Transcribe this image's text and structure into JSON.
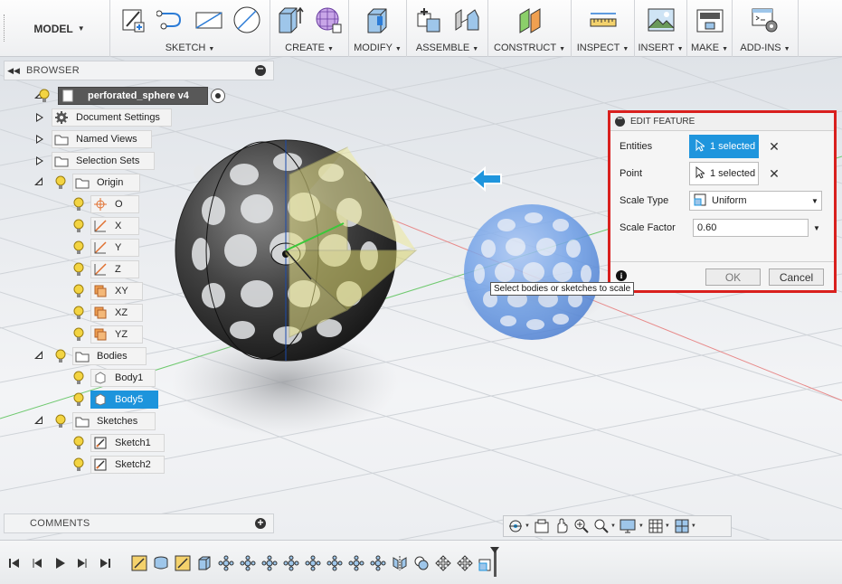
{
  "toolbar": {
    "workspace": "MODEL",
    "groups": [
      {
        "label": "SKETCH",
        "icons": [
          "create-sketch-icon",
          "spline-icon",
          "rectangle-icon",
          "circle-icon"
        ]
      },
      {
        "label": "CREATE",
        "icons": [
          "extrude-icon",
          "box-form-icon"
        ]
      },
      {
        "label": "MODIFY",
        "icons": [
          "press-pull-icon"
        ]
      },
      {
        "label": "ASSEMBLE",
        "icons": [
          "new-component-icon",
          "joint-icon"
        ]
      },
      {
        "label": "CONSTRUCT",
        "icons": [
          "offset-plane-icon"
        ]
      },
      {
        "label": "INSPECT",
        "icons": [
          "measure-icon"
        ]
      },
      {
        "label": "INSERT",
        "icons": [
          "insert-image-icon"
        ]
      },
      {
        "label": "MAKE",
        "icons": [
          "3d-print-icon"
        ]
      },
      {
        "label": "ADD-INS",
        "icons": [
          "scripts-addins-icon"
        ]
      }
    ]
  },
  "browser": {
    "title": "BROWSER",
    "root": "perforated_sphere v4",
    "items": [
      {
        "label": "Document Settings",
        "icon": "gear-icon"
      },
      {
        "label": "Named Views",
        "icon": "folder-icon"
      },
      {
        "label": "Selection Sets",
        "icon": "folder-icon"
      },
      {
        "label": "Origin",
        "icon": "folder-icon"
      },
      {
        "label": "O",
        "icon": "origin-point-icon"
      },
      {
        "label": "X",
        "icon": "axis-icon"
      },
      {
        "label": "Y",
        "icon": "axis-icon"
      },
      {
        "label": "Z",
        "icon": "axis-icon"
      },
      {
        "label": "XY",
        "icon": "plane-icon"
      },
      {
        "label": "XZ",
        "icon": "plane-icon"
      },
      {
        "label": "YZ",
        "icon": "plane-icon"
      },
      {
        "label": "Bodies",
        "icon": "folder-icon"
      },
      {
        "label": "Body1",
        "icon": "body-icon"
      },
      {
        "label": "Body5",
        "icon": "body-icon",
        "selected": true
      },
      {
        "label": "Sketches",
        "icon": "folder-icon"
      },
      {
        "label": "Sketch1",
        "icon": "sketch-icon"
      },
      {
        "label": "Sketch2",
        "icon": "sketch-icon"
      }
    ]
  },
  "comments": {
    "title": "COMMENTS"
  },
  "dialog": {
    "title": "EDIT FEATURE",
    "entities_label": "Entities",
    "entities_value": "1 selected",
    "point_label": "Point",
    "point_value": "1 selected",
    "scale_type_label": "Scale Type",
    "scale_type_value": "Uniform",
    "scale_factor_label": "Scale Factor",
    "scale_factor_value": "0.60",
    "ok": "OK",
    "cancel": "Cancel"
  },
  "tooltip": "Select bodies or sketches to scale",
  "colors": {
    "accent": "#1d94dc",
    "highlight_border": "#d9201e",
    "ghost_body": "#6d9ee6",
    "dark_body": "#3a3a3a"
  },
  "navbar": {
    "icons": [
      "orbit-icon",
      "look-at-icon",
      "pan-icon",
      "zoom-icon",
      "fit-icon",
      "display-settings-icon",
      "grid-icon",
      "viewports-icon"
    ]
  },
  "timeline": {
    "controls": [
      "first-icon",
      "previous-icon",
      "play-icon",
      "next-icon",
      "last-icon"
    ],
    "items": [
      "sketch-feature-icon",
      "revolve-feature-icon",
      "sketch-feature-icon",
      "extrude-feature-icon",
      "pattern-feature-icon",
      "pattern-feature-icon",
      "pattern-feature-icon",
      "pattern-feature-icon",
      "pattern-feature-icon",
      "pattern-feature-icon",
      "pattern-feature-icon",
      "pattern-feature-icon",
      "mirror-feature-icon",
      "combine-feature-icon",
      "move-feature-icon",
      "move-feature-icon",
      "scale-feature-icon"
    ]
  }
}
